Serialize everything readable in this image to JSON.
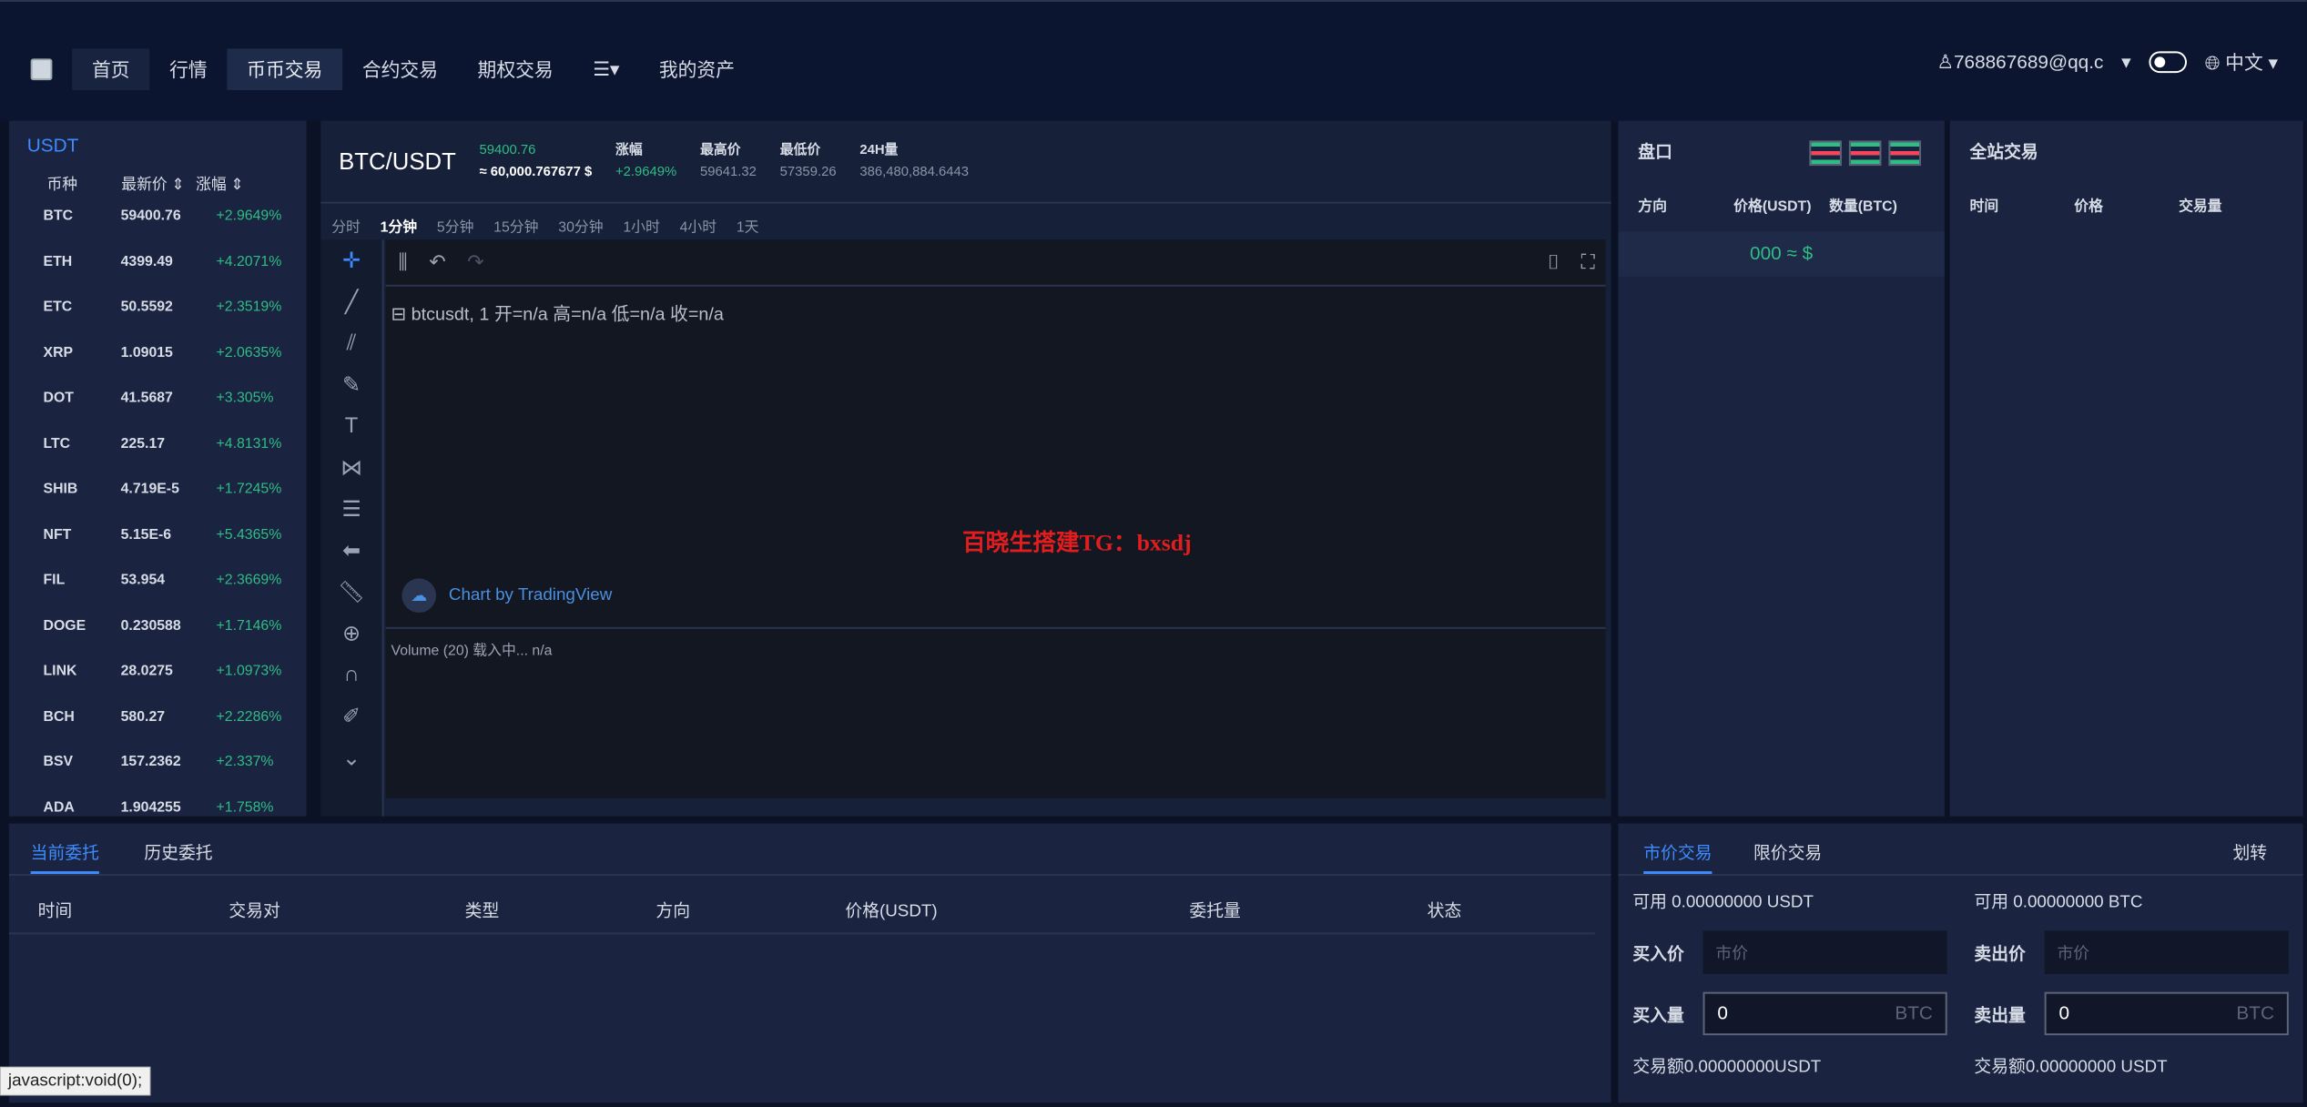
{
  "nav": {
    "items": [
      "首页",
      "行情",
      "币币交易",
      "合约交易",
      "期权交易",
      "我的资产"
    ],
    "user": "768867689@qq.c",
    "lang": "中文"
  },
  "left": {
    "head": "USDT",
    "cols": [
      "币种",
      "最新价",
      "涨幅"
    ],
    "rows": [
      [
        "BTC",
        "59400.76",
        "+2.9649%"
      ],
      [
        "ETH",
        "4399.49",
        "+4.2071%"
      ],
      [
        "ETC",
        "50.5592",
        "+2.3519%"
      ],
      [
        "XRP",
        "1.09015",
        "+2.0635%"
      ],
      [
        "DOT",
        "41.5687",
        "+3.305%"
      ],
      [
        "LTC",
        "225.17",
        "+4.8131%"
      ],
      [
        "SHIB",
        "4.719E-5",
        "+1.7245%"
      ],
      [
        "NFT",
        "5.15E-6",
        "+5.4365%"
      ],
      [
        "FIL",
        "53.954",
        "+2.3669%"
      ],
      [
        "DOGE",
        "0.230588",
        "+1.7146%"
      ],
      [
        "LINK",
        "28.0275",
        "+1.0973%"
      ],
      [
        "BCH",
        "580.27",
        "+2.2286%"
      ],
      [
        "BSV",
        "157.2362",
        "+2.337%"
      ],
      [
        "ADA",
        "1.904255",
        "+1.758%"
      ]
    ]
  },
  "ticker": {
    "pair": "BTC/USDT",
    "price": "59400.76",
    "approx": "≈ 60,000.767677 $",
    "change_l": "涨幅",
    "change_v": "+2.9649%",
    "high_l": "最高价",
    "high_v": "59641.32",
    "low_l": "最低价",
    "low_v": "57359.26",
    "vol_l": "24H量",
    "vol_v": "386,480,884.6443"
  },
  "intervals": [
    "分时",
    "1分钟",
    "5分钟",
    "15分钟",
    "30分钟",
    "1小时",
    "4小时",
    "1天"
  ],
  "chart": {
    "legend": "⊟ btcusdt, 1  开=n/a  高=n/a  低=n/a  收=n/a",
    "watermark": "百晓生搭建TG：bxsdj",
    "tv": "Chart by TradingView",
    "volume": "Volume (20) 载入中...   n/a"
  },
  "book": {
    "title": "盘口",
    "cols": [
      "方向",
      "价格(USDT)",
      "数量(BTC)"
    ],
    "mid": "000 ≈ $"
  },
  "trades": {
    "title": "全站交易",
    "cols": [
      "时间",
      "价格",
      "交易量"
    ]
  },
  "orders": {
    "tabs": [
      "当前委托",
      "历史委托"
    ],
    "cols": [
      "时间",
      "交易对",
      "类型",
      "方向",
      "价格(USDT)",
      "委托量",
      "状态"
    ]
  },
  "form": {
    "tabs": [
      "市价交易",
      "限价交易"
    ],
    "transfer": "划转",
    "buy_avail": "可用 0.00000000 USDT",
    "sell_avail": "可用 0.00000000 BTC",
    "buy_price": "买入价",
    "sell_price": "卖出价",
    "market": "市价",
    "buy_amt": "买入量",
    "sell_amt": "卖出量",
    "zero": "0",
    "unit": "BTC",
    "buy_total": "交易额0.00000000USDT",
    "sell_total": "交易额0.00000000 USDT"
  },
  "status": "javascript:void(0);"
}
